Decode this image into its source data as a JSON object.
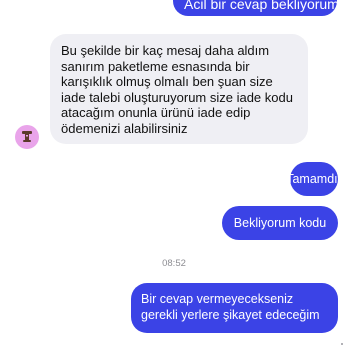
{
  "messages": {
    "outgoing_1": "Acil bir cevap bekliyorum",
    "incoming_1": "Bu şekilde bir kaç mesaj daha aldım sanırım paketleme esnasında bir karışıklık olmuş olmalı ben şuan size iade talebi oluşturuyorum size iade kodu atacağım onunla ürünü iade edip ödemenizi alabilirsiniz",
    "outgoing_2": "Tamamdır",
    "outgoing_3": "Bekliyorum kodu",
    "timestamp": "08:52",
    "outgoing_4": "Bir cevap vermeyecekseniz gerekli yerlere şikayet edeceğim"
  },
  "avatar": {
    "icon": "robot-icon",
    "color": "#e9a4ea"
  },
  "colors": {
    "outgoing_bubble": "#3b43e6",
    "incoming_bubble": "#efeff4",
    "timestamp": "#8e8e93"
  }
}
